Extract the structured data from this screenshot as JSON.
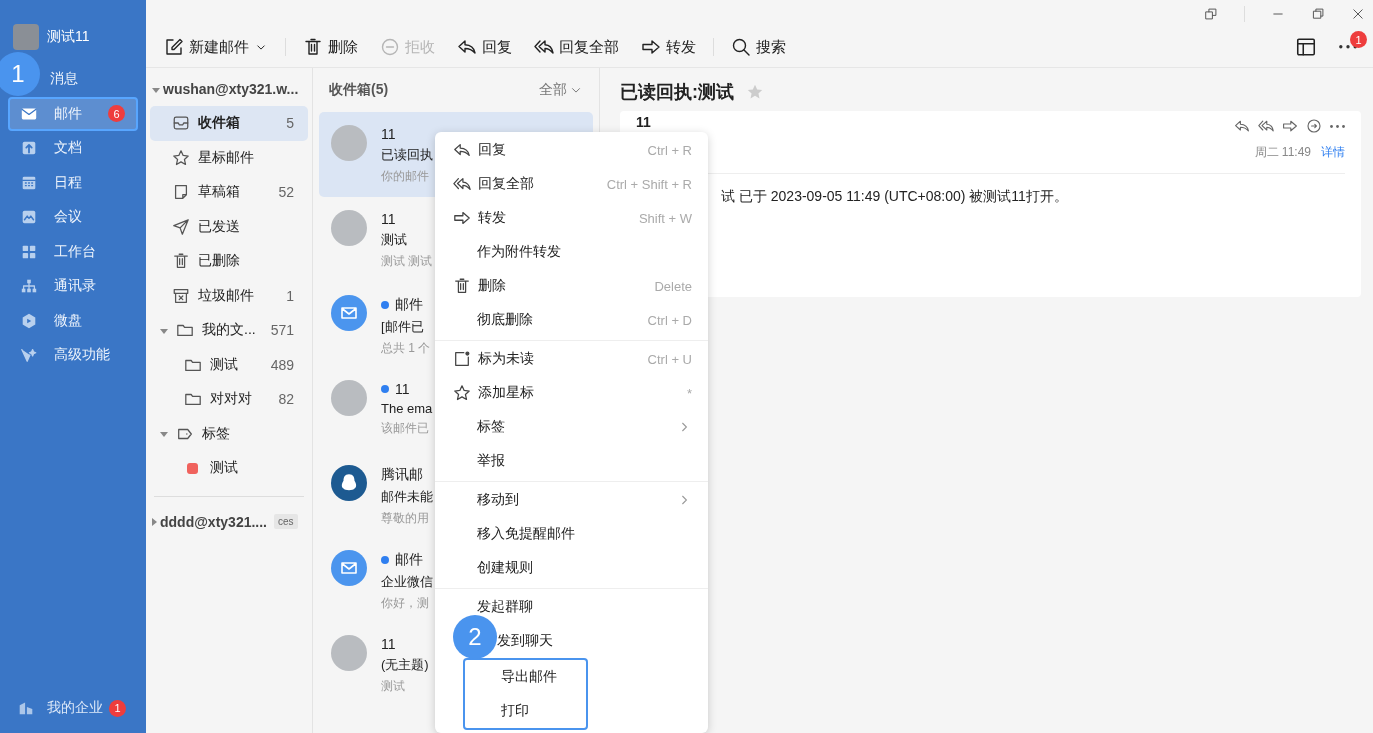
{
  "sidebar": {
    "user": {
      "name": "测试11"
    },
    "items": [
      {
        "label": "消息",
        "selected": false,
        "callout": "1"
      },
      {
        "label": "邮件",
        "selected": true,
        "badge": "6",
        "highlighted": true
      },
      {
        "label": "文档",
        "selected": false
      },
      {
        "label": "日程",
        "selected": false
      },
      {
        "label": "会议",
        "selected": false
      },
      {
        "label": "工作台",
        "selected": false
      },
      {
        "label": "通讯录",
        "selected": false
      },
      {
        "label": "微盘",
        "selected": false
      },
      {
        "label": "高级功能",
        "selected": false
      }
    ],
    "footer": {
      "label": "我的企业",
      "badge": "1"
    }
  },
  "toolbar": {
    "buttons": [
      {
        "label": "新建邮件",
        "disabled": false,
        "dropdown": true
      },
      {
        "label": "删除",
        "disabled": false
      },
      {
        "label": "拒收",
        "disabled": true
      },
      {
        "label": "回复",
        "disabled": false
      },
      {
        "label": "回复全部",
        "disabled": false
      },
      {
        "label": "转发",
        "disabled": false
      },
      {
        "label": "搜索",
        "disabled": false
      }
    ],
    "more_badge": "1"
  },
  "folders": {
    "accounts": [
      {
        "name": "wushan@xty321.w...",
        "expanded": true,
        "folders": [
          {
            "label": "收件箱",
            "count": "5",
            "selected": true
          },
          {
            "label": "星标邮件",
            "selected": false
          },
          {
            "label": "草稿箱",
            "count": "52",
            "selected": false
          },
          {
            "label": "已发送",
            "selected": false
          },
          {
            "label": "已删除",
            "selected": false
          },
          {
            "label": "垃圾邮件",
            "count": "1",
            "selected": false
          },
          {
            "label": "我的文...",
            "count": "571",
            "selected": false,
            "expanded": true,
            "children": [
              {
                "label": "测试",
                "count": "489",
                "selected": false
              },
              {
                "label": "对对对",
                "count": "82",
                "selected": false
              }
            ]
          },
          {
            "label": "标签",
            "selected": false,
            "expanded": true,
            "kind": "tags",
            "children": [
              {
                "label": "测试",
                "selected": false,
                "color": "#f0625d"
              }
            ]
          }
        ]
      },
      {
        "name": "dddd@xty321....",
        "expanded": false,
        "tag": "ces"
      }
    ]
  },
  "message_list": {
    "title": "收件箱(5)",
    "filter": "全部",
    "messages": [
      {
        "kind": "photo",
        "sender": "11",
        "subject": "已读回执",
        "preview": "你的邮件",
        "unread": false,
        "selected": true
      },
      {
        "kind": "photo",
        "sender": "11",
        "subject": "测试",
        "preview": "测试 测试",
        "unread": false,
        "selected": false
      },
      {
        "kind": "mail",
        "sender": "邮件",
        "subject": "[邮件已",
        "preview": "总共 1 个",
        "unread": true,
        "selected": false
      },
      {
        "kind": "photo",
        "sender": "11",
        "subject": "The ema",
        "preview": "该邮件已",
        "unread": true,
        "selected": false
      },
      {
        "kind": "penguin",
        "sender": "腾讯邮",
        "subject": "邮件未能",
        "preview": "尊敬的用",
        "unread": false,
        "selected": false
      },
      {
        "kind": "mail",
        "sender": "邮件",
        "subject": "企业微信",
        "preview": "你好，测",
        "unread": true,
        "selected": false
      },
      {
        "kind": "photo",
        "sender": "11",
        "subject": "(无主题)",
        "preview": "测试",
        "unread": false,
        "selected": false
      }
    ]
  },
  "reading_pane": {
    "title": "已读回执:测试",
    "starred": false,
    "sender": "11",
    "time": "周二 11:49",
    "details_link": "详情",
    "body": "试 已于 2023-09-05 11:49 (UTC+08:00) 被测试11打开。"
  },
  "context_menu": {
    "sections": [
      {
        "items": [
          {
            "label": "回复",
            "shortcut": "Ctrl + R"
          },
          {
            "label": "回复全部",
            "shortcut": "Ctrl + Shift + R"
          },
          {
            "label": "转发",
            "shortcut": "Shift + W"
          },
          {
            "label": "作为附件转发"
          },
          {
            "label": "删除",
            "shortcut": "Delete"
          },
          {
            "label": "彻底删除",
            "shortcut": "Ctrl + D"
          }
        ]
      },
      {
        "items": [
          {
            "label": "标为未读",
            "shortcut": "Ctrl + U"
          },
          {
            "label": "添加星标",
            "shortcut": "*"
          },
          {
            "label": "标签",
            "submenu": true
          },
          {
            "label": "举报"
          }
        ]
      },
      {
        "items": [
          {
            "label": "移动到",
            "submenu": true
          },
          {
            "label": "移入免提醒邮件"
          },
          {
            "label": "创建规则"
          }
        ]
      },
      {
        "items": [
          {
            "label": "发起群聊"
          },
          {
            "label": "发到聊天",
            "callout": "2"
          },
          {
            "label": "导出邮件",
            "highlighted": true
          },
          {
            "label": "打印",
            "highlighted": true
          }
        ]
      }
    ]
  }
}
